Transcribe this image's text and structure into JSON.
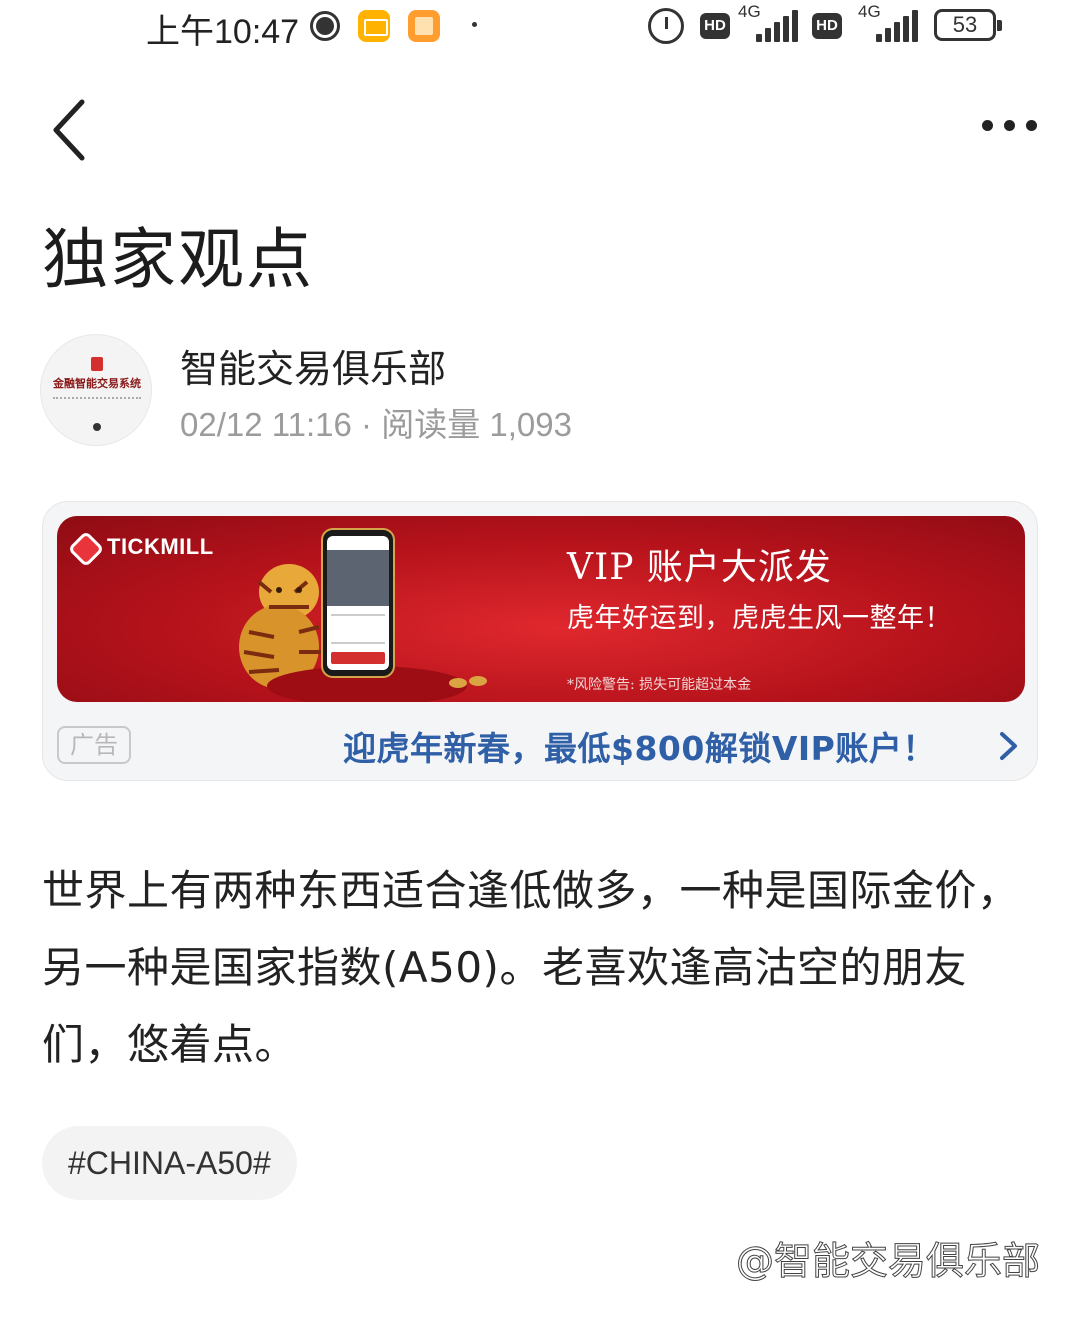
{
  "status_bar": {
    "time": "上午10:47",
    "network_left": "4G",
    "network_right": "4G",
    "hd_label": "HD",
    "battery": "53"
  },
  "nav": {
    "back_icon": "chevron-left-icon",
    "more_icon": "more-horizontal-icon"
  },
  "page": {
    "title": "独家观点"
  },
  "author": {
    "name": "智能交易俱乐部",
    "avatar_text": "金融智能交易系统",
    "meta": "02/12 11:16 · 阅读量 1,093"
  },
  "ad": {
    "brand": "TICKMILL",
    "headline": "VIP 账户大派发",
    "subline": "虎年好运到，虎虎生风一整年！",
    "risk_warning": "*风险警告: 损失可能超过本金",
    "tag": "广告",
    "cta": "迎虎年新春，最低$800解锁VIP账户！",
    "colors": {
      "banner_red": "#b5121b",
      "cta_blue": "#2f5fa7",
      "gold": "#d9a441"
    }
  },
  "article": {
    "body": "世界上有两种东西适合逢低做多，一种是国际金价，另一种是国家指数(A50)。老喜欢逢高沽空的朋友们，悠着点。"
  },
  "tags": [
    "#CHINA-A50#"
  ],
  "watermark": "@智能交易俱乐部"
}
